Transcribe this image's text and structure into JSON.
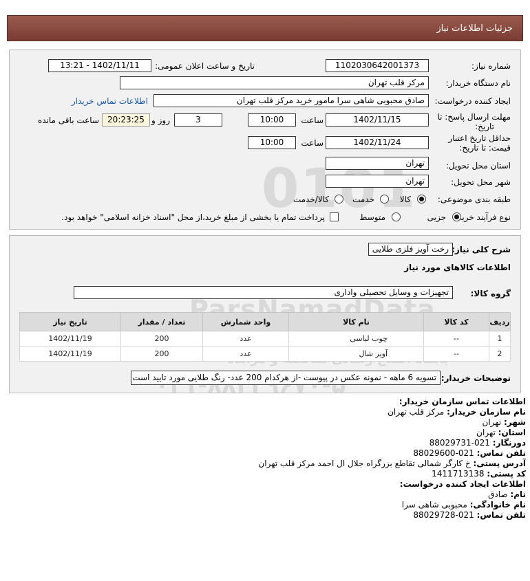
{
  "header": {
    "title": "جزئیات اطلاعات نیاز"
  },
  "form": {
    "need_number_label": "شماره نیاز:",
    "need_number": "1102030642001373",
    "announce_label": "تاریخ و ساعت اعلان عمومی:",
    "announce_value": "1402/11/11 - 13:21",
    "buyer_label": "نام دستگاه خریدار:",
    "buyer_value": "مرکز قلب تهران",
    "creator_label": "ایجاد کننده درخواست:",
    "creator_value": "صادق محبوبی شاهی سرا مامور خرید مرکز قلب تهران",
    "contact_link": "اطلاعات تماس خریدار",
    "deadline_label_1": "مهلت ارسال پاسخ: تا",
    "deadline_label_2": "تاریخ:",
    "deadline_date": "1402/11/15",
    "time_label": "ساعت",
    "deadline_time": "10:00",
    "days_value": "3",
    "days_label": "روز و",
    "remaining_time": "20:23:25",
    "remaining_label": "ساعت باقی مانده",
    "validity_label_1": "حداقل تاریخ اعتبار",
    "validity_label_2": "قیمت: تا تاریخ:",
    "validity_date": "1402/11/24",
    "validity_time": "10:00",
    "province_label": "استان محل تحویل:",
    "province_value": "تهران",
    "city_label": "شهر محل تحویل:",
    "city_value": "تهران",
    "category_label": "طبقه بندی موضوعی:",
    "category_options": [
      "کالا",
      "خدمت",
      "کالا/خدمت"
    ],
    "category_selected": "کالا",
    "process_label": "نوع فرآیند خرید :",
    "process_options": [
      "جزیی",
      "متوسط"
    ],
    "process_selected": "جزیی",
    "payment_text": "پرداخت تمام یا بخشی از مبلغ خرید،از محل \"اسناد خزانه اسلامی\" خواهد بود."
  },
  "need": {
    "summary_label": "شرح کلی نیاز:",
    "summary_value": "رخت آویز فلزی طلایی",
    "goods_heading": "اطلاعات کالاهای مورد نیاز",
    "group_label": "گروه کالا:",
    "group_value": "تجهیزات و وسایل تحصیلی واداری",
    "columns": [
      "ردیف",
      "کد کالا",
      "نام کالا",
      "واحد شمارش",
      "تعداد / مقدار",
      "تاریخ نیاز"
    ],
    "rows": [
      [
        "1",
        "--",
        "چوب لباسی",
        "عدد",
        "200",
        "1402/11/19"
      ],
      [
        "2",
        "--",
        "آویز شال",
        "عدد",
        "200",
        "1402/11/19"
      ]
    ],
    "buyer_notes_label": "توضیحات خریدار:",
    "buyer_notes_value": "تسویه 6 ماهه - نمونه عکس در پیوست -از هرکدام 200 عدد- رنگ طلایی مورد تایید است"
  },
  "watermark": {
    "brand": "ParsNamadData",
    "line1": "مرکز فرآوری اطلاعات پارس نماد داده ها",
    "line2": "پایگاه اطلاع رسانی مناقصه و مزایده",
    "phone": "۰۲۱-۸۸۳۴۹۶۷۰-۵"
  },
  "contact": {
    "org_heading": "اطلاعات تماس سازمان خریدار:",
    "buyer_name_label": "نام سازمان خریدار:",
    "buyer_name": "مرکز قلب تهران",
    "city_label": "شهر:",
    "city": "تهران",
    "province_label": "استان:",
    "province": "تهران",
    "fax_label": "دورنگار:",
    "fax": "021-88029731",
    "phone_label": "تلفن تماس:",
    "phone": "021-88029600",
    "address_label": "آدرس پستی:",
    "address": "خ کارگر شمالی تقاطع بزرگراه جلال ال احمد مرکز قلب تهران",
    "postal_label": "کد پستی:",
    "postal": "1411713138",
    "creator_heading": "اطلاعات ایجاد کننده درخواست:",
    "first_name_label": "نام:",
    "first_name": "صادق",
    "last_name_label": "نام خانوادگی:",
    "last_name": "محبوبی شاهی سرا",
    "creator_phone_label": "تلفن تماس:",
    "creator_phone": "021-88029728"
  }
}
